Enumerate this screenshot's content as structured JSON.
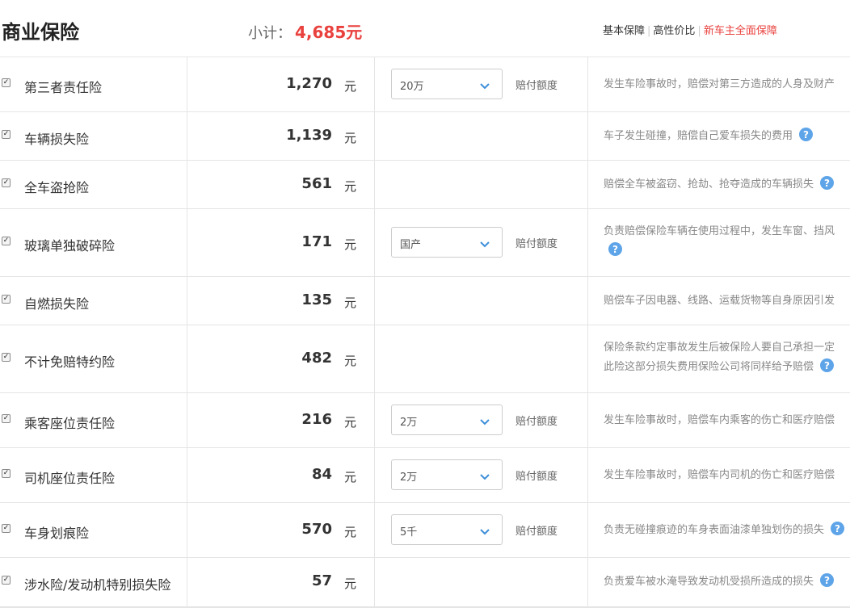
{
  "header": {
    "title": "商业保险",
    "subtotal_label": "小计：",
    "subtotal_value": "4,685元",
    "plans": [
      "基本保障",
      "高性价比",
      "新车主全面保障"
    ]
  },
  "colors": {
    "accent": "#e9413e",
    "help": "#5ea4e8"
  },
  "rows": [
    {
      "name": "第三者责任险",
      "price": "1,270",
      "unit": "元",
      "option": "20万",
      "option_label": "赔付额度",
      "desc": [
        "发生车险事故时，赔偿对第三方造成的人身及财产"
      ],
      "help": false
    },
    {
      "name": "车辆损失险",
      "price": "1,139",
      "unit": "元",
      "option": "",
      "option_label": "",
      "desc": [
        "车子发生碰撞，赔偿自己爱车损失的费用"
      ],
      "help": true
    },
    {
      "name": "全车盗抢险",
      "price": "561",
      "unit": "元",
      "option": "",
      "option_label": "",
      "desc": [
        "赔偿全车被盗窃、抢劫、抢夺造成的车辆损失"
      ],
      "help": true
    },
    {
      "name": "玻璃单独破碎险",
      "price": "171",
      "unit": "元",
      "option": "国产",
      "option_label": "赔付额度",
      "desc": [
        "负责赔偿保险车辆在使用过程中，发生车窗、挡风",
        ""
      ],
      "help": true
    },
    {
      "name": "自燃损失险",
      "price": "135",
      "unit": "元",
      "option": "",
      "option_label": "",
      "desc": [
        "赔偿车子因电器、线路、运载货物等自身原因引发"
      ],
      "help": false
    },
    {
      "name": "不计免赔特约险",
      "price": "482",
      "unit": "元",
      "option": "",
      "option_label": "",
      "desc": [
        "保险条款约定事故发生后被保险人要自己承担一定",
        "此险这部分损失费用保险公司将同样给予赔偿"
      ],
      "help": true
    },
    {
      "name": "乘客座位责任险",
      "price": "216",
      "unit": "元",
      "option": "2万",
      "option_label": "赔付额度",
      "desc": [
        "发生车险事故时，赔偿车内乘客的伤亡和医疗赔偿"
      ],
      "help": false
    },
    {
      "name": "司机座位责任险",
      "price": "84",
      "unit": "元",
      "option": "2万",
      "option_label": "赔付额度",
      "desc": [
        "发生车险事故时，赔偿车内司机的伤亡和医疗赔偿"
      ],
      "help": false
    },
    {
      "name": "车身划痕险",
      "price": "570",
      "unit": "元",
      "option": "5千",
      "option_label": "赔付额度",
      "desc": [
        "负责无碰撞痕迹的车身表面油漆单独划伤的损失"
      ],
      "help": true
    },
    {
      "name": "涉水险/发动机特别损失险",
      "price": "57",
      "unit": "元",
      "option": "",
      "option_label": "",
      "desc": [
        "负责爱车被水淹导致发动机受损所造成的损失"
      ],
      "help": true
    }
  ]
}
